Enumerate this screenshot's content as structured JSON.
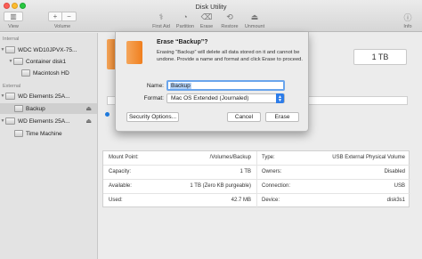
{
  "window": {
    "title": "Disk Utility"
  },
  "toolbar": {
    "view_label": "View",
    "volume_label": "Volume",
    "first_aid_label": "First Aid",
    "partition_label": "Partition",
    "erase_label": "Erase",
    "restore_label": "Restore",
    "unmount_label": "Unmount",
    "info_label": "Info"
  },
  "sidebar": {
    "internal_label": "Internal",
    "external_label": "External",
    "items": [
      {
        "label": "WDC WD10JPVX-75..."
      },
      {
        "label": "Container disk1"
      },
      {
        "label": "Macintosh HD"
      },
      {
        "label": "WD Elements 25A..."
      },
      {
        "label": "Backup"
      },
      {
        "label": "WD Elements 25A..."
      },
      {
        "label": "Time Machine"
      }
    ]
  },
  "main": {
    "capacity_box": "1 TB",
    "info": {
      "left": [
        {
          "label": "Mount Point:",
          "value": "/Volumes/Backup"
        },
        {
          "label": "Capacity:",
          "value": "1 TB"
        },
        {
          "label": "Available:",
          "value": "1 TB (Zero KB purgeable)"
        },
        {
          "label": "Used:",
          "value": "42.7 MB"
        }
      ],
      "right": [
        {
          "label": "Type:",
          "value": "USB External Physical Volume"
        },
        {
          "label": "Owners:",
          "value": "Disabled"
        },
        {
          "label": "Connection:",
          "value": "USB"
        },
        {
          "label": "Device:",
          "value": "disk3s1"
        }
      ]
    }
  },
  "sheet": {
    "title": "Erase “Backup”?",
    "description": "Erasing “Backup” will delete all data stored on it and cannot be undone. Provide a name and format and click Erase to proceed.",
    "name_label": "Name:",
    "name_value": "Backup",
    "format_label": "Format:",
    "format_value": "Mac OS Extended (Journaled)",
    "security_options_label": "Security Options...",
    "cancel_label": "Cancel",
    "erase_label": "Erase"
  },
  "colors": {
    "accent": "#2e7de9",
    "drive_orange": "#f07f1e"
  }
}
